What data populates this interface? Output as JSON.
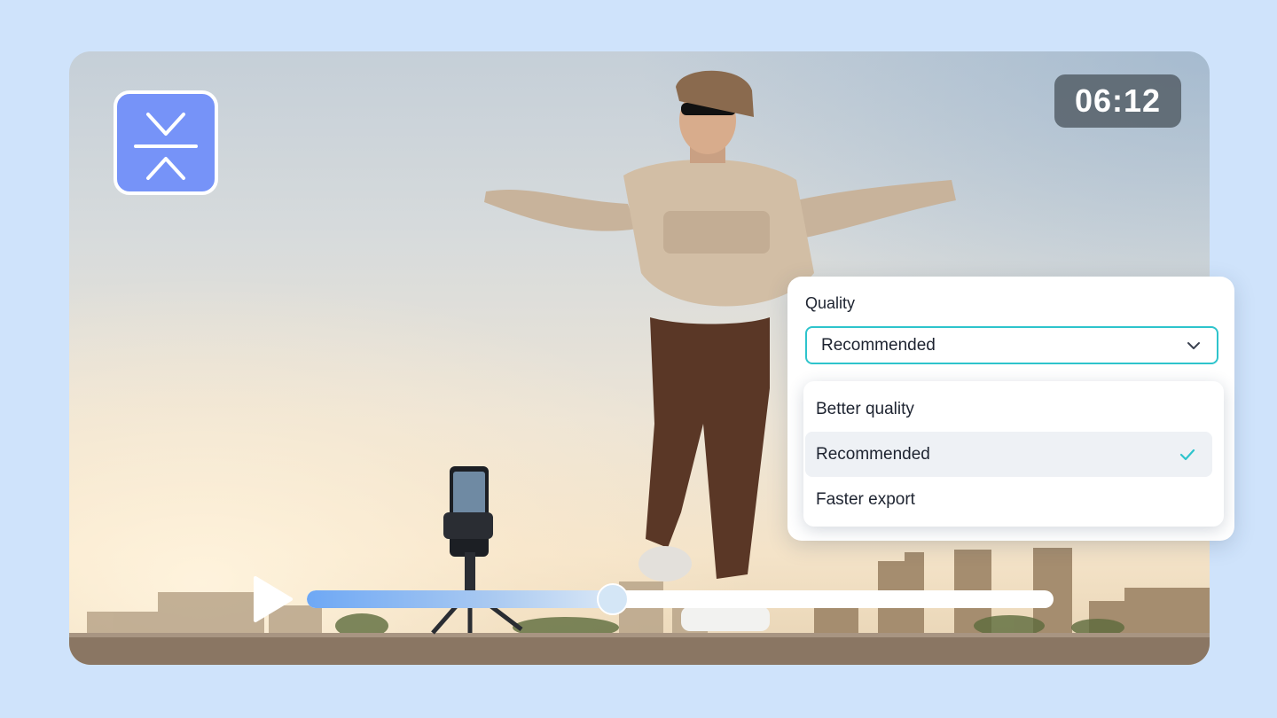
{
  "video": {
    "timer": "06:12",
    "progress": 0.41
  },
  "quality": {
    "label": "Quality",
    "selected": "Recommended",
    "options": [
      {
        "label": "Better quality",
        "selected": false
      },
      {
        "label": "Recommended",
        "selected": true
      },
      {
        "label": "Faster export",
        "selected": false
      }
    ]
  },
  "colors": {
    "background": "#cfe3fb",
    "logo": "#7693f8",
    "accent": "#2ec4cc",
    "progress_start": "#6ea8f5"
  },
  "icons": [
    "collapse-icon",
    "play-icon",
    "chevron-down-icon",
    "checkmark-icon"
  ]
}
